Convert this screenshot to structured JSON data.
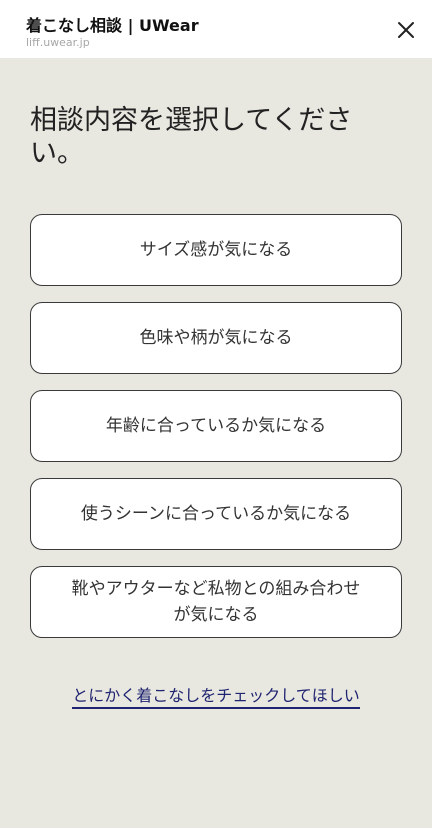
{
  "header": {
    "title": "着こなし相談 | UWear",
    "url": "liff.uwear.jp",
    "close_icon": "close-icon"
  },
  "main": {
    "title": "相談内容を選択してください。",
    "options": [
      "サイズ感が気になる",
      "色味や柄が気になる",
      "年齢に合っているか気になる",
      "使うシーンに合っているか気になる",
      "靴やアウターなど私物との組み合わせが気になる"
    ],
    "link_label": "とにかく着こなしをチェックしてほしい"
  },
  "colors": {
    "background": "#e8e7e0",
    "link": "#1f2470"
  }
}
